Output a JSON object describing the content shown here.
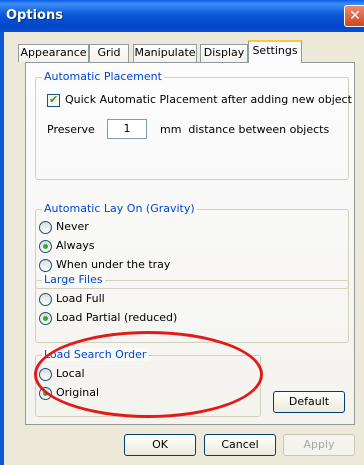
{
  "window": {
    "title": "Options",
    "close_icon": "close-icon",
    "close_glyph": "✕"
  },
  "tabs": [
    {
      "label": "Appearance",
      "active": false
    },
    {
      "label": "Grid",
      "active": false
    },
    {
      "label": "Manipulate",
      "active": false
    },
    {
      "label": "Display",
      "active": false
    },
    {
      "label": "Settings",
      "active": true
    }
  ],
  "automatic_placement": {
    "legend": "Automatic Placement",
    "quick_checkbox": {
      "label": "Quick Automatic Placement after adding new object",
      "checked": true
    },
    "preserve_label": "Preserve",
    "preserve_value": "1",
    "preserve_suffix": "mm  distance between objects"
  },
  "gravity": {
    "legend": "Automatic Lay On (Gravity)",
    "options": [
      {
        "label": "Never",
        "selected": false
      },
      {
        "label": "Always",
        "selected": true
      },
      {
        "label": "When under the tray",
        "selected": false
      }
    ]
  },
  "large_files": {
    "legend": "Large Files",
    "options": [
      {
        "label": "Load Full",
        "selected": false
      },
      {
        "label": "Load Partial (reduced)",
        "selected": true
      }
    ]
  },
  "load_search_order": {
    "legend": "Load Search Order",
    "options": [
      {
        "label": "Local",
        "selected": false
      },
      {
        "label": "Original",
        "selected": true
      }
    ]
  },
  "buttons": {
    "default": "Default",
    "ok": "OK",
    "cancel": "Cancel",
    "apply": "Apply"
  },
  "colors": {
    "annotation": "#e21a1a",
    "accent": "#0046d5"
  }
}
